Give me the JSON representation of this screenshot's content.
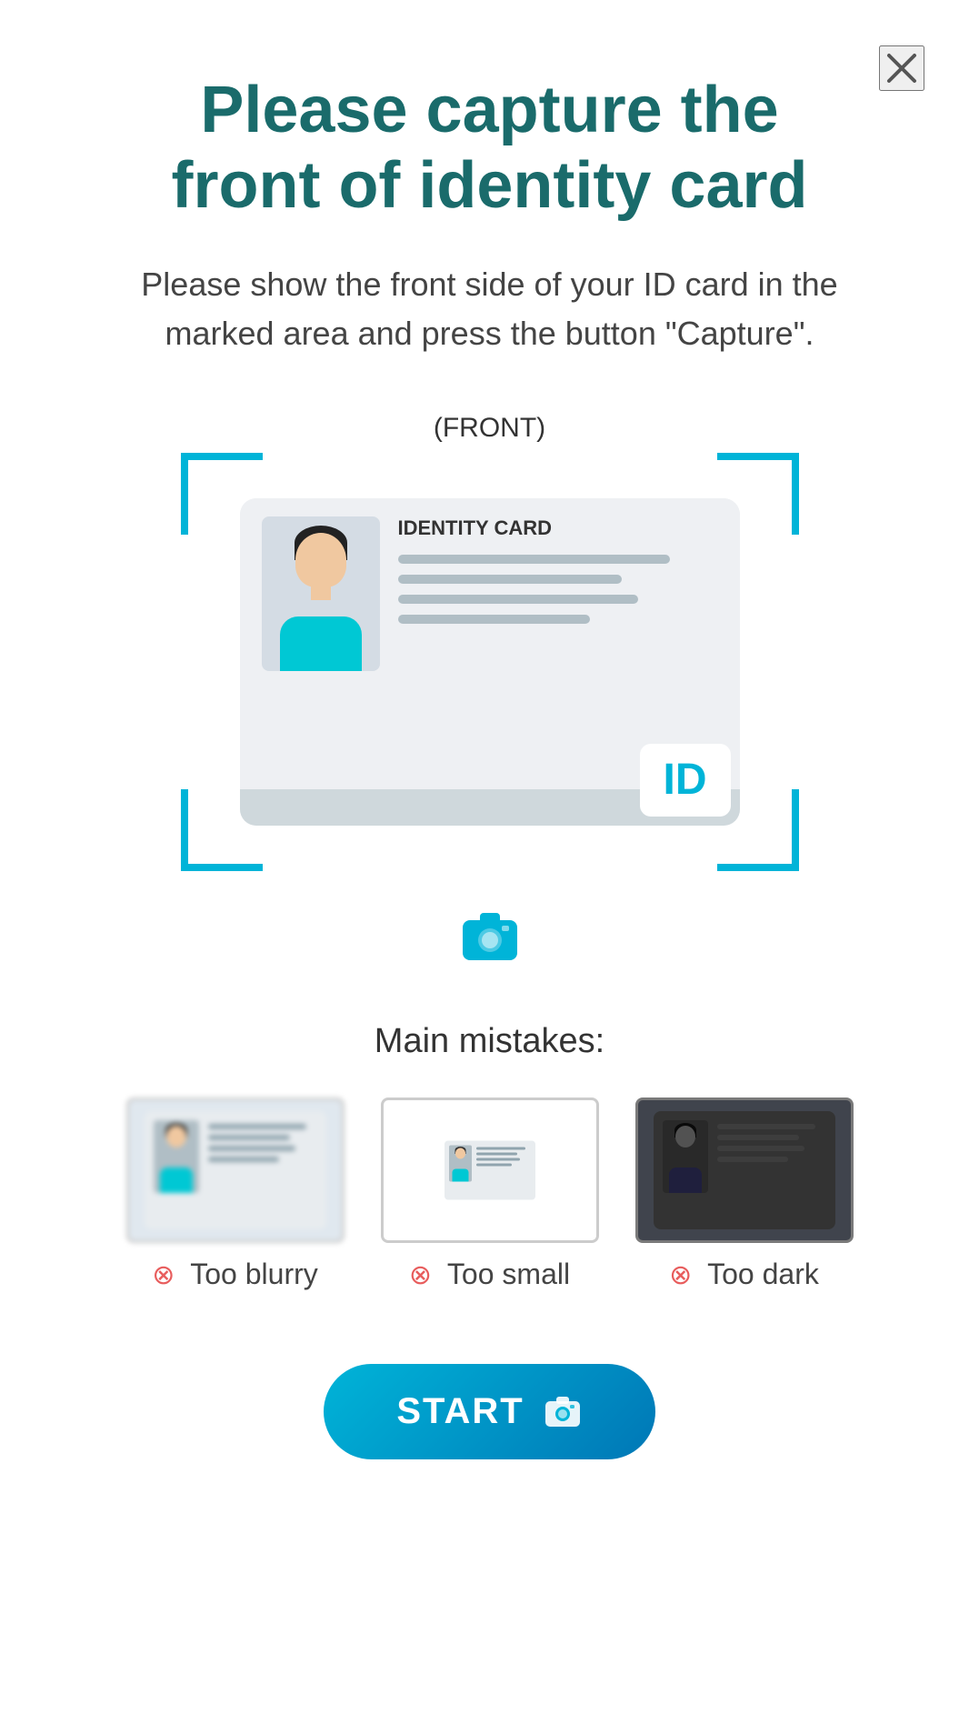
{
  "header": {
    "title_line1": "Please capture the",
    "title_line2": "front of identity card"
  },
  "subtitle": "Please show the front side of your ID card in the marked area and press the button \"Capture\".",
  "scan_label": "(FRONT)",
  "id_card": {
    "title": "IDENTITY CARD"
  },
  "mistakes_section": {
    "title": "Main mistakes:",
    "items": [
      {
        "label": "Too blurry",
        "type": "blurry"
      },
      {
        "label": "Too small",
        "type": "small"
      },
      {
        "label": "Too dark",
        "type": "dark"
      }
    ]
  },
  "start_button": {
    "label": "START"
  },
  "close_button": {
    "label": "Close"
  }
}
